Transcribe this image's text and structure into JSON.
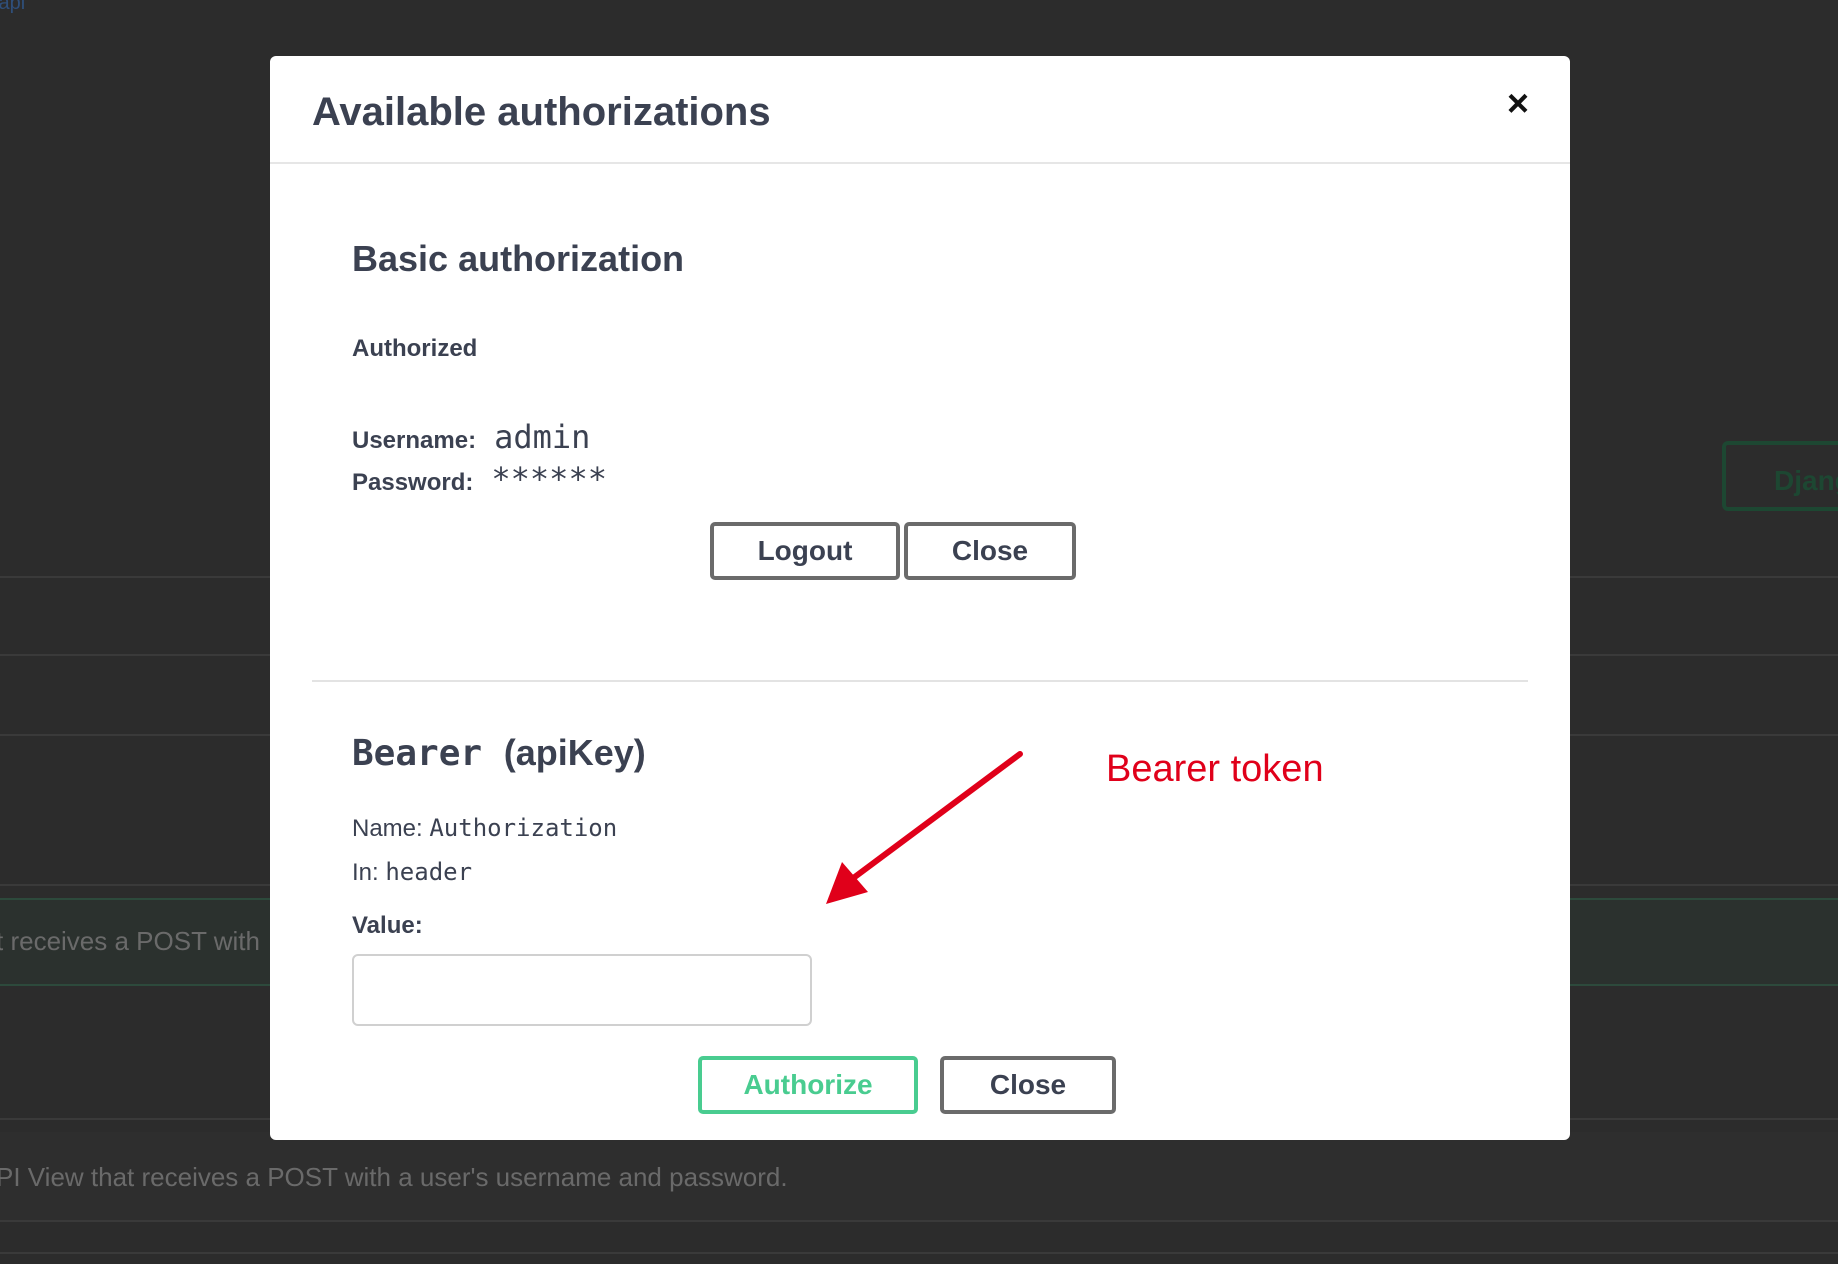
{
  "background": {
    "link_fragment": "iapi",
    "row_text_1": "t receives a POST with",
    "row_text_2": "PI View that receives a POST with a user's username and password.",
    "pill_label": "Djang"
  },
  "modal": {
    "title": "Available authorizations",
    "close_icon": "×",
    "basic": {
      "title": "Basic authorization",
      "status": "Authorized",
      "username_label": "Username:",
      "username_value": "admin",
      "password_label": "Password:",
      "password_value": "******",
      "logout_label": "Logout",
      "close_label": "Close"
    },
    "bearer": {
      "title_mono": "Bearer",
      "title_rest": "(apiKey)",
      "name_label": "Name:",
      "name_value": "Authorization",
      "in_label": "In:",
      "in_value": "header",
      "value_label": "Value:",
      "value_input": "",
      "value_placeholder": "",
      "authorize_label": "Authorize",
      "close_label": "Close"
    }
  },
  "annotation": {
    "text": "Bearer token",
    "color": "#e0001a"
  },
  "colors": {
    "authorize_accent": "#49cc90",
    "text": "#3b4151",
    "overlay": "#2c2c2c"
  }
}
